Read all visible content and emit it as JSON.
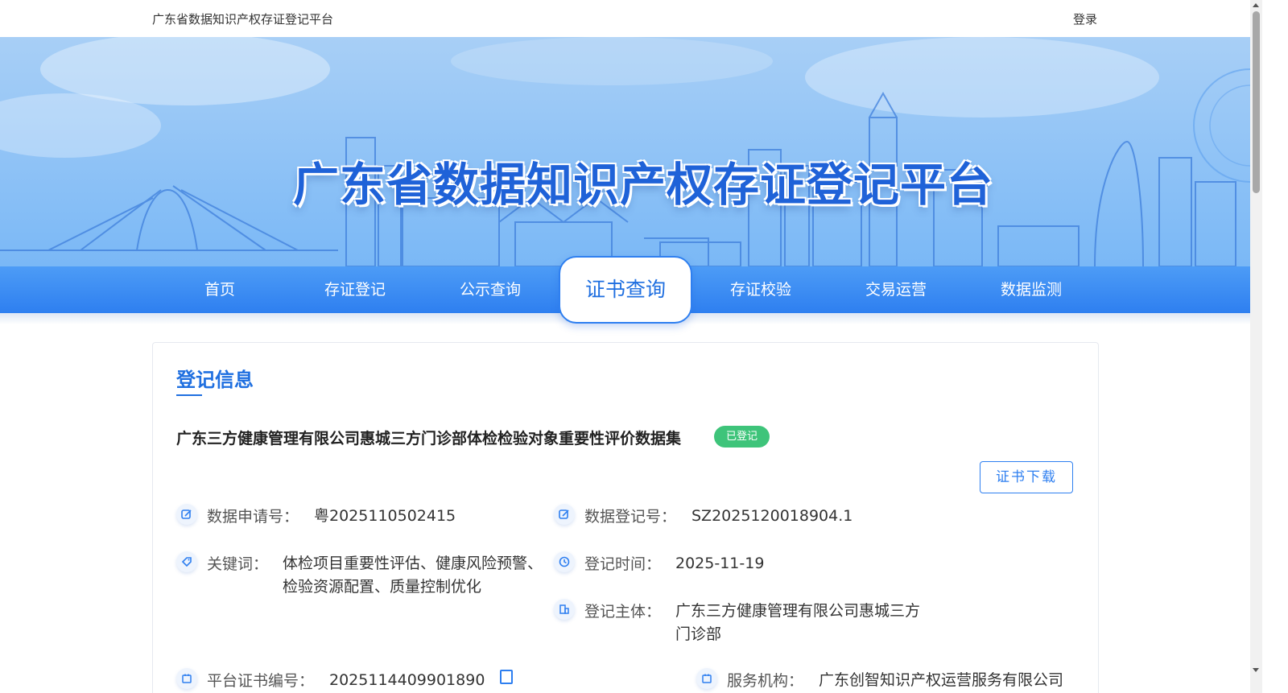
{
  "header": {
    "site_name": "广东省数据知识产权存证登记平台",
    "login_label": "登录"
  },
  "banner": {
    "title": "广东省数据知识产权存证登记平台"
  },
  "nav": {
    "items": [
      {
        "label": "首页"
      },
      {
        "label": "存证登记"
      },
      {
        "label": "公示查询"
      },
      {
        "label": "证书查询",
        "active": true
      },
      {
        "label": "存证校验"
      },
      {
        "label": "交易运营"
      },
      {
        "label": "数据监测"
      }
    ]
  },
  "record": {
    "section_title": "登记信息",
    "title": "广东三方健康管理有限公司惠城三方门诊部体检检验对象重要性评价数据集",
    "status": "已登记",
    "download_label": "证书下载",
    "fields": {
      "application_no": {
        "label": "数据申请号：",
        "value": "粤2025110502415"
      },
      "registration_no": {
        "label": "数据登记号：",
        "value": "SZ2025120018904.1"
      },
      "keywords": {
        "label": "关键词：",
        "value": "体检项目重要性评估、健康风险预警、检验资源配置、质量控制优化"
      },
      "registration_time": {
        "label": "登记时间：",
        "value": "2025-11-19"
      },
      "registrant": {
        "label": "登记主体：",
        "value": "广东三方健康管理有限公司惠城三方门诊部"
      },
      "certificate_no": {
        "label": "平台证书编号：",
        "value": "2025114409901890"
      },
      "service_org": {
        "label": "服务机构：",
        "value": "广东创智知识产权运营服务有限公司"
      }
    }
  },
  "colors": {
    "primary": "#1f6fe0",
    "nav_bg": "#2e7ff0",
    "status_green": "#3ec47a"
  }
}
